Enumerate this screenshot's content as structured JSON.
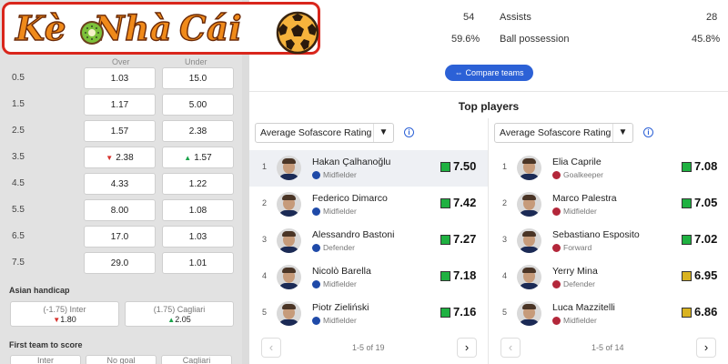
{
  "brand": {
    "part1": "Kè",
    "part2": "Nhà",
    "part3": "Cái"
  },
  "odds": {
    "col_over": "Over",
    "col_under": "Under",
    "rows": [
      {
        "line": "0.5",
        "over": "1.03",
        "under": "15.0",
        "over_trend": "",
        "under_trend": ""
      },
      {
        "line": "1.5",
        "over": "1.17",
        "under": "5.00",
        "over_trend": "",
        "under_trend": ""
      },
      {
        "line": "2.5",
        "over": "1.57",
        "under": "2.38",
        "over_trend": "",
        "under_trend": ""
      },
      {
        "line": "3.5",
        "over": "2.38",
        "under": "1.57",
        "over_trend": "down",
        "under_trend": "up"
      },
      {
        "line": "4.5",
        "over": "4.33",
        "under": "1.22",
        "over_trend": "",
        "under_trend": ""
      },
      {
        "line": "5.5",
        "over": "8.00",
        "under": "1.08",
        "over_trend": "",
        "under_trend": ""
      },
      {
        "line": "6.5",
        "over": "17.0",
        "under": "1.03",
        "over_trend": "",
        "under_trend": ""
      },
      {
        "line": "7.5",
        "over": "29.0",
        "under": "1.01",
        "over_trend": "",
        "under_trend": ""
      }
    ],
    "asian_handicap": {
      "title": "Asian handicap",
      "home_label": "(-1.75) Inter",
      "home_value": "1.80",
      "home_trend": "down",
      "away_label": "(1.75) Cagliari",
      "away_value": "2.05",
      "away_trend": "up"
    },
    "first_team_to_score": {
      "title": "First team to score",
      "options": [
        "Inter",
        "No goal",
        "Cagliari"
      ]
    }
  },
  "stats": {
    "left_value_1": "54",
    "left_value_2": "59.6%",
    "left_label_2_partial": "n",
    "right_label_1": "Assists",
    "right_value_1": "28",
    "right_label_2": "Ball possession",
    "right_value_2": "45.8%"
  },
  "compare_button": "Compare teams",
  "top_players": {
    "title": "Top players",
    "home": {
      "selector": "Average Sofascore Rating",
      "pagination": "1-5 of 19",
      "players": [
        {
          "rank": "1",
          "name": "Hakan Çalhanoğlu",
          "position": "Midfielder",
          "rating": "7.50",
          "rating_color": "#1fb141",
          "highlight": true
        },
        {
          "rank": "2",
          "name": "Federico Dimarco",
          "position": "Midfielder",
          "rating": "7.42",
          "rating_color": "#1fb141"
        },
        {
          "rank": "3",
          "name": "Alessandro Bastoni",
          "position": "Defender",
          "rating": "7.27",
          "rating_color": "#1fb141"
        },
        {
          "rank": "4",
          "name": "Nicolò Barella",
          "position": "Midfielder",
          "rating": "7.18",
          "rating_color": "#1fb141"
        },
        {
          "rank": "5",
          "name": "Piotr Zieliński",
          "position": "Midfielder",
          "rating": "7.16",
          "rating_color": "#1fb141"
        }
      ]
    },
    "away": {
      "selector": "Average Sofascore Rating",
      "pagination": "1-5 of 14",
      "players": [
        {
          "rank": "1",
          "name": "Elia Caprile",
          "position": "Goalkeeper",
          "rating": "7.08",
          "rating_color": "#1fb141"
        },
        {
          "rank": "2",
          "name": "Marco Palestra",
          "position": "Midfielder",
          "rating": "7.05",
          "rating_color": "#1fb141"
        },
        {
          "rank": "3",
          "name": "Sebastiano Esposito",
          "position": "Forward",
          "rating": "7.02",
          "rating_color": "#1fb141"
        },
        {
          "rank": "4",
          "name": "Yerry Mina",
          "position": "Defender",
          "rating": "6.95",
          "rating_color": "#d9b321"
        },
        {
          "rank": "5",
          "name": "Luca Mazzitelli",
          "position": "Midfielder",
          "rating": "6.86",
          "rating_color": "#d9b321"
        }
      ]
    }
  },
  "colors": {
    "accent": "#2c61d6",
    "logo_border": "#d9261c",
    "logo_text": "#f08a1a",
    "rating_good": "#1fb141",
    "rating_ok": "#d9b321",
    "inter_badge": "#1f4aa8",
    "cagliari_badge": "#b3273a"
  }
}
